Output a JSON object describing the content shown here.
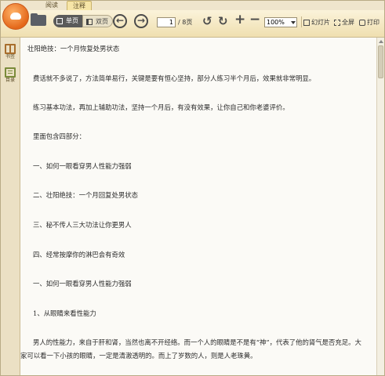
{
  "tabs": [
    {
      "label": "阅读",
      "active": false
    },
    {
      "label": "注释",
      "active": true
    }
  ],
  "toolbar": {
    "single_page_label": "单页",
    "double_page_label": "双页",
    "current_page": "1",
    "page_total": "/ 8页",
    "zoom_value": "100%",
    "slideshow_label": "幻灯片",
    "fullscreen_label": "全屏",
    "print_label": "打印"
  },
  "sidebar": {
    "items": [
      {
        "label": "书签",
        "icon": "bookmark-icon"
      },
      {
        "label": "目录",
        "icon": "toc-icon"
      }
    ]
  },
  "document": {
    "paragraphs": [
      "壮阳绝技：一个月恢复处男状态",
      "费话就不多说了，方法简单易行，关键是要有恒心坚持，部分人练习半个月后，效果就非常明显。",
      "练习基本功法，再加上辅助功法，坚持一个月后，有没有效果，让你自己和你老婆评价。",
      "里面包含四部分：",
      "一、如何一眼看穿男人性能力强弱",
      "二、壮阳绝技：一个月回复处男状态",
      "三、秘不传人三大功法让你更男人",
      "四、经常按摩你的淋巴会有奇效",
      "一、如何一眼看穿男人性能力强弱",
      "1、从眼睛来看性能力",
      "男人的性能力，来自于肝和肾，当然也离不开经络。而一个人的眼睛是不是有“神”，代表了他的肾气是否充足。大家可以看一下小孩的眼睛，一定是清澈透明的。而上了岁数的人，则是人老珠黄。"
    ]
  },
  "colors": {
    "accent": "#e4681a",
    "toolbar_bg": "#efdfb0",
    "page_bg": "#fbfaf6"
  }
}
